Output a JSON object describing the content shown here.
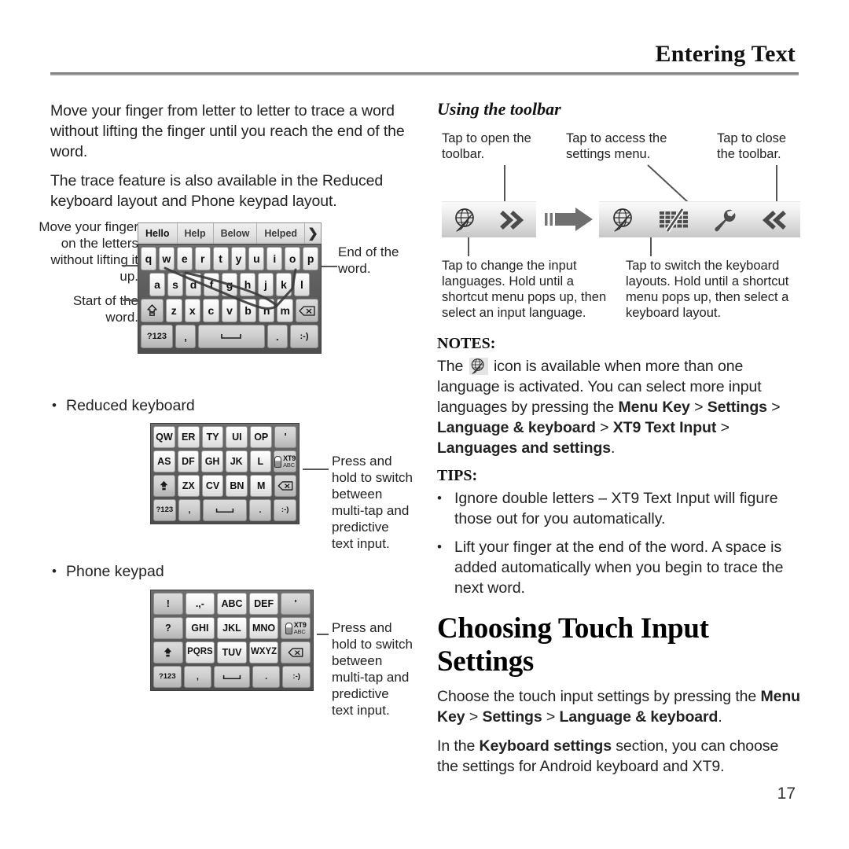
{
  "header": {
    "title": "Entering Text"
  },
  "page_number": "17",
  "left_column": {
    "paragraphs": [
      "Move your finger from letter to letter to trace a word without lifting the finger until you reach the end of the word.",
      "The trace feature is also available in the Reduced keyboard layout and Phone keypad layout."
    ],
    "qwerty_figure": {
      "annotations": {
        "top_left": "Move your finger on the letters without lifting it up.",
        "bottom_left": "Start of the word.",
        "right": "End of the word."
      },
      "suggestions": [
        "Hello",
        "Help",
        "Below",
        "Helped"
      ],
      "suggestion_more_icon": "chevron-right-icon",
      "rows": [
        [
          "q",
          "w",
          "e",
          "r",
          "t",
          "y",
          "u",
          "i",
          "o",
          "p"
        ],
        [
          "a",
          "s",
          "d",
          "f",
          "g",
          "h",
          "j",
          "k",
          "l"
        ],
        [
          "shift-icon",
          "z",
          "x",
          "c",
          "v",
          "b",
          "n",
          "m",
          "backspace-icon"
        ],
        [
          "?123",
          ",",
          "space-icon",
          ".",
          ":-)"
        ]
      ]
    },
    "bullets": [
      "Reduced keyboard",
      "Phone keypad"
    ],
    "reduced_figure": {
      "rows": [
        [
          "QW",
          "ER",
          "TY",
          "UI",
          "OP",
          "'"
        ],
        [
          "AS",
          "DF",
          "GH",
          "JK",
          "L",
          "xt9-abc-key"
        ],
        [
          "shift-icon",
          "ZX",
          "CV",
          "BN",
          "M",
          "backspace-icon"
        ],
        [
          "?123",
          ",",
          "space-icon",
          ".",
          ":-)"
        ]
      ],
      "callout": "Press and hold to switch between multi-tap and predictive text input.",
      "xt9_key_line1": "XT9",
      "xt9_key_line2": "ABC"
    },
    "phone_figure": {
      "rows": [
        [
          "!",
          ".,-",
          "ABC",
          "DEF",
          "'"
        ],
        [
          "?",
          "GHI",
          "JKL",
          "MNO",
          "xt9-abc-key"
        ],
        [
          "shift-icon",
          "PQRS",
          "TUV",
          "WXYZ",
          "backspace-icon"
        ],
        [
          "?123",
          ",",
          "space-icon",
          ".",
          ":-)"
        ]
      ],
      "callout": "Press and hold to switch between multi-tap and predictive text input.",
      "xt9_key_line1": "XT9",
      "xt9_key_line2": "ABC"
    }
  },
  "right_column": {
    "subheading": "Using the toolbar",
    "toolbar": {
      "caption_open": "Tap to open the toolbar.",
      "caption_settings": "Tap to access the settings menu.",
      "caption_close": "Tap to close the toolbar.",
      "caption_languages": "Tap to change the input languages. Hold until a shortcut menu pops up, then select an input language.",
      "caption_layouts": "Tap to switch the keyboard layouts. Hold until a shortcut menu pops up, then select a keyboard layout.",
      "collapsed_icons": [
        "globe-icon",
        "double-chevron-right-icon"
      ],
      "expanded_icons": [
        "globe-icon",
        "keyboard-layout-icon",
        "wrench-icon",
        "double-chevron-left-icon"
      ],
      "arrow_icon": "right-arrow-icon"
    },
    "notes": {
      "label": "NOTES:",
      "text_before_icon": "The",
      "icon": "globe-icon",
      "text_after_icon_1": "icon is available when more than one language is activated. You can select more input languages by pressing the",
      "bold_1": "Menu Key",
      "sep_1": ">",
      "bold_2": "Settings",
      "sep_2": ">",
      "bold_3": "Language & keyboard",
      "sep_3": ">",
      "bold_4": "XT9 Text Input",
      "sep_4": ">",
      "bold_5": "Languages and settings",
      "period": "."
    },
    "tips": {
      "label": "TIPS:",
      "items": [
        "Ignore double letters – XT9 Text Input will figure those out for you automatically.",
        "Lift your finger at the end of the word. A space is added automatically when you begin to trace the next word."
      ]
    },
    "choosing": {
      "heading": "Choosing Touch Input Settings",
      "para1_a": "Choose the touch input settings by pressing the",
      "para1_b1": "Menu Key",
      "para1_s1": ">",
      "para1_b2": "Settings",
      "para1_s2": ">",
      "para1_b3": "Language & keyboard",
      "para1_end": ".",
      "para2_a": "In the",
      "para2_b1": "Keyboard settings",
      "para2_end": "section, you can choose the settings for Android keyboard and XT9."
    }
  },
  "colors": {
    "rule": "#8d8d8d",
    "key_face": "#f2f2f2",
    "kbd_shell": "#5d5d5d",
    "toolbar_bg": "#e4e4e4"
  }
}
